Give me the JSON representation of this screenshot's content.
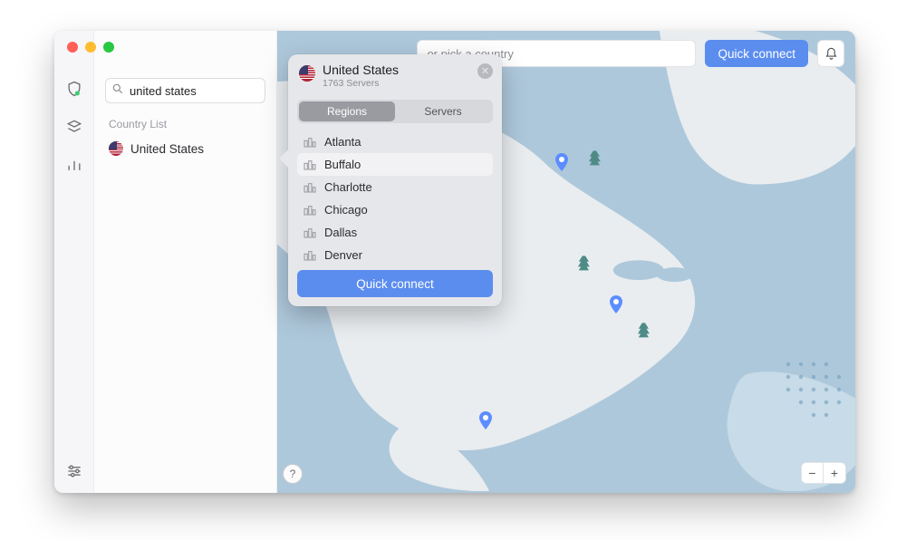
{
  "search": {
    "value": "united states",
    "section_label": "Country List"
  },
  "country": {
    "name": "United States"
  },
  "toolbar": {
    "country_placeholder": "or pick a country",
    "quick_connect": "Quick connect"
  },
  "popover": {
    "title": "United States",
    "servers_count": "1763 Servers",
    "tabs": {
      "regions": "Regions",
      "servers": "Servers"
    },
    "active_tab": "regions",
    "regions": [
      "Atlanta",
      "Buffalo",
      "Charlotte",
      "Chicago",
      "Dallas",
      "Denver"
    ],
    "hover_index": 1,
    "quick_connect": "Quick connect"
  },
  "help_label": "?",
  "zoom": {
    "out": "−",
    "in": "+"
  }
}
